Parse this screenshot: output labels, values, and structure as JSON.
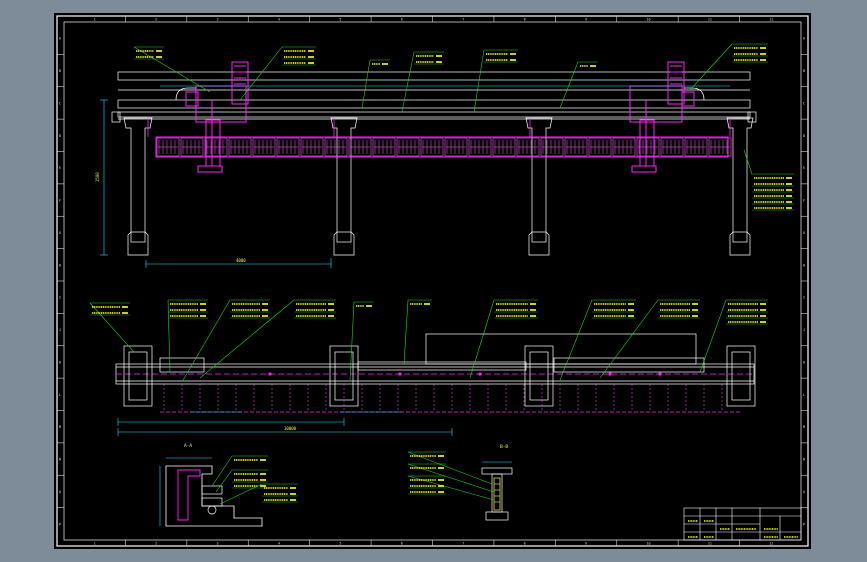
{
  "window": {
    "background": "#7e8b99"
  },
  "sheet": {
    "background": "#000000",
    "frame_color": "#ffffff",
    "inner_frame_color": "#20c8ff"
  },
  "border_ticks": {
    "top": [
      "1",
      "2",
      "3",
      "4",
      "5",
      "6",
      "7",
      "8",
      "9",
      "10",
      "11",
      "12"
    ],
    "left": [
      "A",
      "B",
      "C",
      "D",
      "E",
      "F",
      "G",
      "H",
      "I",
      "J",
      "K",
      "L",
      "M",
      "N",
      "O",
      "P"
    ]
  },
  "colors": {
    "outline": "#ffffff",
    "dimension": "#20e0ff",
    "leader": "#19d919",
    "annotation": "#ffff33",
    "parts": "#ff20ff",
    "hatch": "#ff60ff"
  },
  "labels": {
    "section_a": "A-A",
    "section_b": "B-B",
    "dim_top": "1500",
    "dim_bottom": "10000",
    "dim_mid": "4000"
  },
  "title_block": {
    "company": "",
    "drawing_title": ""
  }
}
